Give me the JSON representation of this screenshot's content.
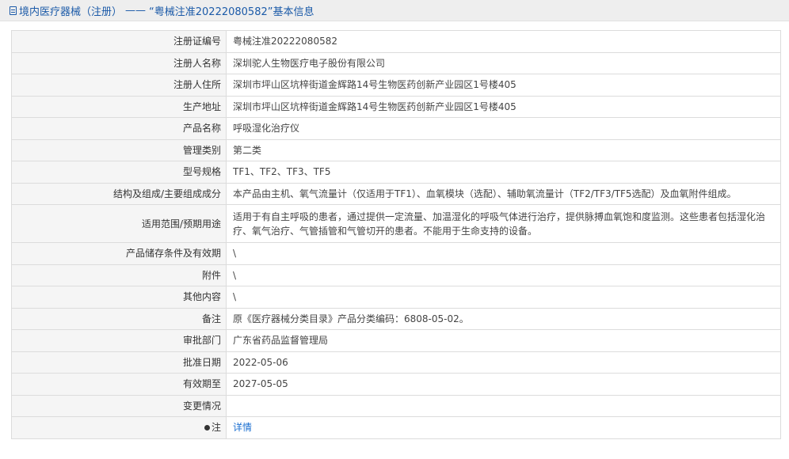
{
  "header": {
    "category": "境内医疗器械（注册）",
    "separator": "——",
    "title": "“粤械注准20222080582”基本信息"
  },
  "rows": [
    {
      "label": "注册证编号",
      "value": "粤械注准20222080582"
    },
    {
      "label": "注册人名称",
      "value": "深圳驼人生物医疗电子股份有限公司"
    },
    {
      "label": "注册人住所",
      "value": "深圳市坪山区坑梓街道金辉路14号生物医药创新产业园区1号楼405"
    },
    {
      "label": "生产地址",
      "value": "深圳市坪山区坑梓街道金辉路14号生物医药创新产业园区1号楼405"
    },
    {
      "label": "产品名称",
      "value": "呼吸湿化治疗仪"
    },
    {
      "label": "管理类别",
      "value": "第二类"
    },
    {
      "label": "型号规格",
      "value": "TF1、TF2、TF3、TF5"
    },
    {
      "label": "结构及组成/主要组成成分",
      "value": "本产品由主机、氧气流量计（仅适用于TF1）、血氧模块（选配）、辅助氧流量计（TF2/TF3/TF5选配）及血氧附件组成。"
    },
    {
      "label": "适用范围/预期用途",
      "value": "适用于有自主呼吸的患者，通过提供一定流量、加温湿化的呼吸气体进行治疗，提供脉搏血氧饱和度监测。这些患者包括湿化治疗、氧气治疗、气管插管和气管切开的患者。不能用于生命支持的设备。"
    },
    {
      "label": "产品储存条件及有效期",
      "value": "\\"
    },
    {
      "label": "附件",
      "value": "\\"
    },
    {
      "label": "其他内容",
      "value": "\\"
    },
    {
      "label": "备注",
      "value": "原《医疗器械分类目录》产品分类编码：6808-05-02。"
    },
    {
      "label": "审批部门",
      "value": "广东省药品监督管理局"
    },
    {
      "label": "批准日期",
      "value": "2022-05-06"
    },
    {
      "label": "有效期至",
      "value": "2027-05-05"
    },
    {
      "label": "变更情况",
      "value": ""
    }
  ],
  "note_row": {
    "label": "注",
    "icon": "bulb-icon",
    "link_text": "详情"
  }
}
